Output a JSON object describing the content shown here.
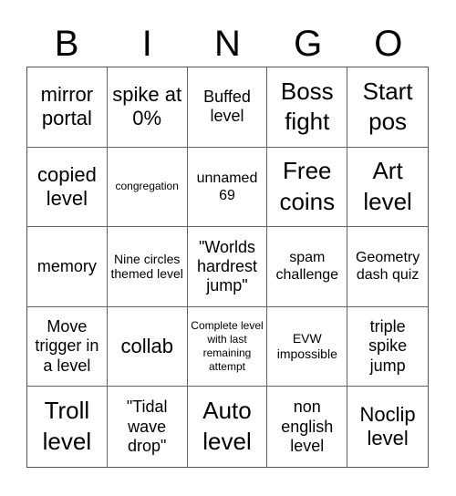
{
  "header": {
    "letters": [
      "B",
      "I",
      "N",
      "G",
      "O"
    ]
  },
  "cells": [
    [
      "mirror portal",
      "spike at 0%",
      "Buffed level",
      "Boss fight",
      "Start pos"
    ],
    [
      "copied level",
      "congregation",
      "unnamed 69",
      "Free coins",
      "Art level"
    ],
    [
      "memory",
      "Nine circles themed level",
      "\"Worlds hardrest jump\"",
      "spam challenge",
      "Geometry dash quiz"
    ],
    [
      "Move trigger in a level",
      "collab",
      "Complete level with last remaining attempt",
      "EVW impossible",
      "triple spike jump"
    ],
    [
      "Troll level",
      "\"Tidal wave drop\"",
      "Auto level",
      "non english level",
      "Noclip level"
    ]
  ]
}
